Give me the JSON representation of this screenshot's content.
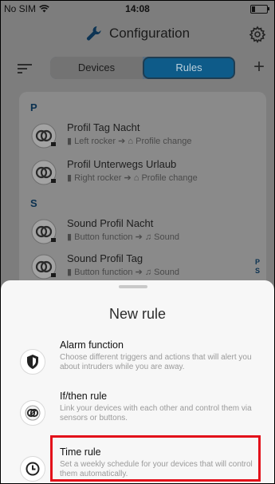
{
  "status": {
    "carrier": "No SIM",
    "time": "14:08",
    "battery_fraction": 0.2
  },
  "header": {
    "title": "Configuration",
    "icons": [
      "wrench-icon",
      "gear-icon"
    ]
  },
  "tabs": [
    {
      "label": "Devices",
      "selected": false
    },
    {
      "label": "Rules",
      "selected": true
    }
  ],
  "sections": [
    {
      "letter": "P",
      "rules": [
        {
          "name": "Profil Tag Nacht",
          "trigger": "Left rocker",
          "action": "Profile change"
        },
        {
          "name": "Profil Unterwegs Urlaub",
          "trigger": "Right rocker",
          "action": "Profile change"
        }
      ]
    },
    {
      "letter": "S",
      "rules": [
        {
          "name": "Sound Profil Nacht",
          "trigger": "Button function",
          "action": "Sound"
        },
        {
          "name": "Sound Profil Tag",
          "trigger": "Button function",
          "action": "Sound"
        }
      ]
    }
  ],
  "index_letters": [
    "P",
    "S"
  ],
  "sheet": {
    "title": "New rule",
    "options": [
      {
        "name": "Alarm function",
        "description": "Choose different triggers and actions that will alert you about intruders while you are away.",
        "icon": "shield-icon"
      },
      {
        "name": "If/then rule",
        "description": "Link your devices with each other and control them via sensors or buttons.",
        "icon": "link-icon"
      },
      {
        "name": "Time rule",
        "description": "Set a weekly schedule for your devices that will control them automatically.",
        "icon": "clock-icon",
        "highlighted": true
      }
    ]
  },
  "colors": {
    "accent": "#0e5b89",
    "highlight": "#e3101a",
    "section": "#0b3150"
  }
}
